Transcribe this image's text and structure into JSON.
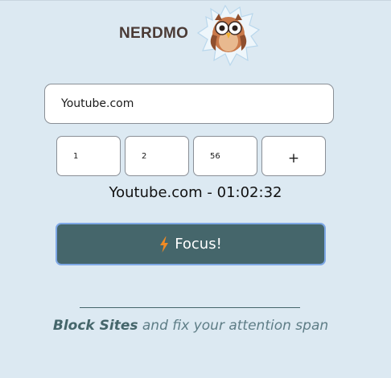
{
  "header": {
    "brand_name": "NERDMO",
    "logo_icon": "owl-icon"
  },
  "site": {
    "value": "Youtube.com"
  },
  "time": {
    "hours": "1",
    "minutes": "2",
    "seconds": "56",
    "add_label": "+"
  },
  "entry": {
    "text": "Youtube.com - 01:02:32"
  },
  "focus": {
    "label": "Focus!",
    "icon": "lightning-bolt-icon",
    "icon_color": "#f08a24",
    "button_color": "#45666b"
  },
  "footer": {
    "tagline_strong": "Block Sites",
    "tagline_rest": " and fix your attention span"
  },
  "colors": {
    "background": "#dce9f2",
    "accent": "#45666b"
  }
}
